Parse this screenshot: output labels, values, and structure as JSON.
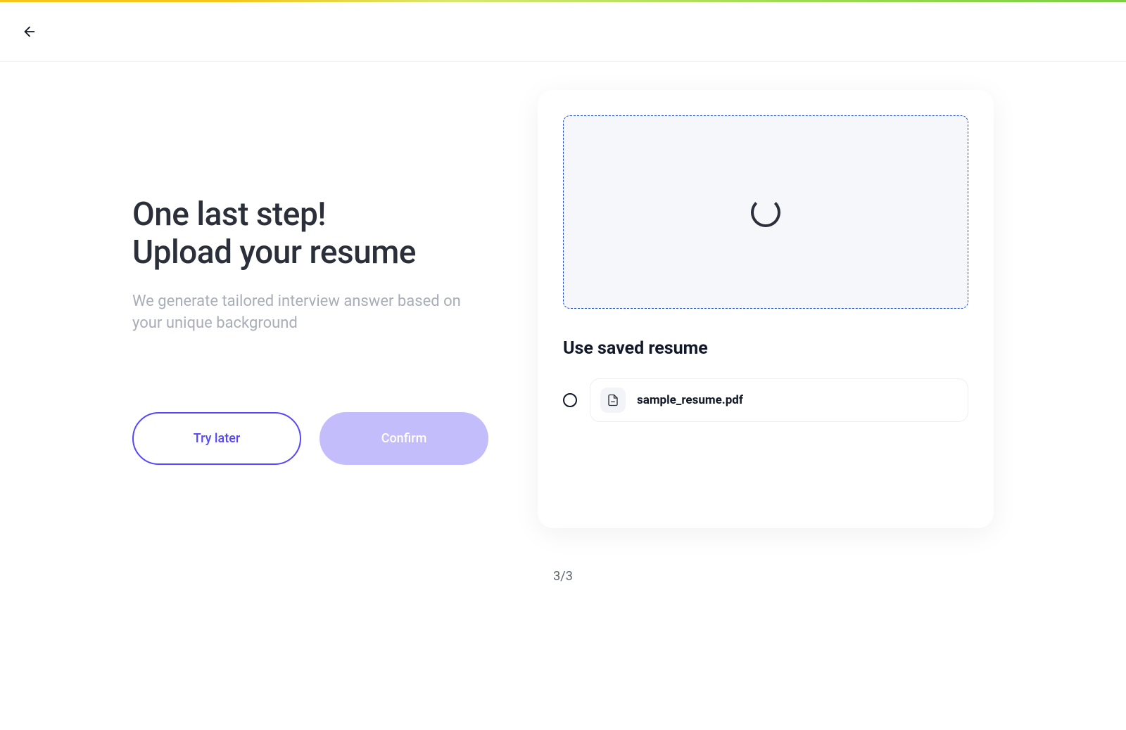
{
  "back_label": "Back",
  "title_line1": "One last step!",
  "title_line2": "Upload your resume",
  "subtitle": "We generate tailored interview answer based on your unique background",
  "buttons": {
    "try_later": "Try later",
    "confirm": "Confirm"
  },
  "upload": {
    "state": "loading"
  },
  "saved_section_heading": "Use saved resume",
  "saved_resumes": [
    {
      "filename": "sample_resume.pdf",
      "selected": false
    }
  ],
  "pager": {
    "current": 3,
    "total": 3,
    "display": "3/3"
  }
}
